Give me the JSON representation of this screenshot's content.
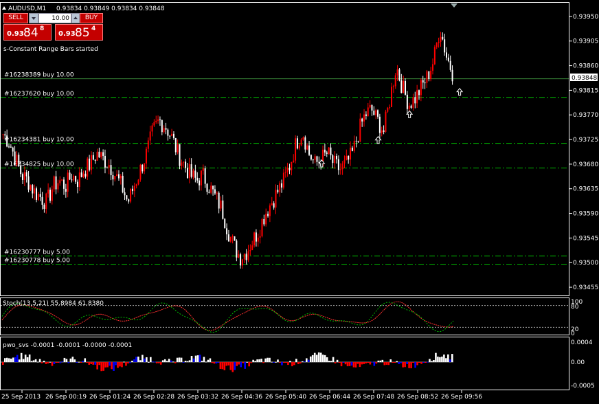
{
  "header": {
    "symbol": "AUDUSD,M1",
    "ohlc": "0.93834 0.93849 0.93834 0.93848",
    "status_message": "s-Constant Range Bars started"
  },
  "trade_panel": {
    "sell_label": "SELL",
    "buy_label": "BUY",
    "lot_value": "10.00",
    "sell_price": {
      "prefix": "0.93",
      "big": "84",
      "sup": "8"
    },
    "buy_price": {
      "prefix": "0.93",
      "big": "85",
      "sup": "4"
    }
  },
  "orders": [
    {
      "label": "#16238389 buy 10.00",
      "price": 0.93836,
      "style": "solid"
    },
    {
      "label": "#16237620 buy 10.00",
      "price": 0.93802,
      "style": "dashdot"
    },
    {
      "label": "#16234381 buy 10.00",
      "price": 0.93718,
      "style": "dashdot"
    },
    {
      "label": "#16234825 buy 10.00",
      "price": 0.93673,
      "style": "dashdot"
    },
    {
      "label": "#16230777 buy 5.00",
      "price": 0.93512,
      "style": "dashdot"
    },
    {
      "label": "#16230778 buy 5.00",
      "price": 0.93497,
      "style": "dashdot"
    }
  ],
  "current_price_label": "0.93848",
  "price_axis": [
    "0.93950",
    "0.93905",
    "0.93860",
    "0.93815",
    "0.93770",
    "0.93725",
    "0.93680",
    "0.93635",
    "0.93590",
    "0.93545",
    "0.93500",
    "0.93455"
  ],
  "time_axis": [
    "25 Sep 2013",
    "26 Sep 00:19",
    "26 Sep 01:24",
    "26 Sep 02:28",
    "26 Sep 03:32",
    "26 Sep 04:36",
    "26 Sep 05:40",
    "26 Sep 06:44",
    "26 Sep 07:48",
    "26 Sep 08:52",
    "26 Sep 09:56"
  ],
  "stoch": {
    "title": "Stoch(13,5,21) 55.8984 61.8380",
    "axis": [
      "100",
      "80",
      "20",
      "0"
    ]
  },
  "pwo": {
    "title": "pwo_svs -0.0001 -0.0001 -0.0000 -0.0001",
    "axis": [
      "0.0004",
      "0.00",
      "-0.0005"
    ]
  },
  "colors": {
    "background": "#000000",
    "bull": "#ff0000",
    "bear": "#ffffff",
    "order_line": "#00c000",
    "stoch_main": "#00c000",
    "stoch_signal": "#ff3030",
    "pwo_pos": "#ffffff",
    "pwo_neg": "#ff0000",
    "pwo_accent": "#0000ff"
  },
  "chart_data": {
    "type": "candlestick",
    "ylim": [
      0.9344,
      0.93975
    ],
    "closes": [
      0.93735,
      0.9372,
      0.9369,
      0.9366,
      0.9365,
      0.9363,
      0.9362,
      0.9361,
      0.9364,
      0.9365,
      0.9364,
      0.9366,
      0.9365,
      0.9367,
      0.9368,
      0.937,
      0.9369,
      0.9368,
      0.9366,
      0.9364,
      0.9361,
      0.9364,
      0.9367,
      0.937,
      0.9374,
      0.9376,
      0.9375,
      0.9373,
      0.937,
      0.9368,
      0.9366,
      0.9365,
      0.9366,
      0.9364,
      0.9362,
      0.936,
      0.9356,
      0.9353,
      0.9351,
      0.9352,
      0.9354,
      0.9356,
      0.9359,
      0.9361,
      0.9363,
      0.9365,
      0.9368,
      0.9372,
      0.9374,
      0.937,
      0.9368,
      0.9369,
      0.937,
      0.9368,
      0.9367,
      0.9368,
      0.937,
      0.9374,
      0.9377,
      0.9378,
      0.9376,
      0.9374,
      0.938,
      0.9386,
      0.9382,
      0.9379,
      0.938,
      0.9382,
      0.9384,
      0.9387,
      0.9393,
      0.9388,
      0.93848
    ],
    "markers": [
      {
        "index": 51,
        "price": 0.93695
      },
      {
        "index": 60,
        "price": 0.93738
      },
      {
        "index": 65,
        "price": 0.93785
      },
      {
        "index": 73,
        "price": 0.93826
      }
    ]
  }
}
